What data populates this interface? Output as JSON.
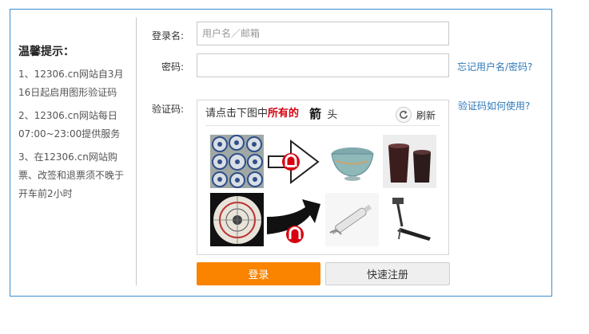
{
  "tips": {
    "title": "温馨提示：",
    "items": [
      "1、12306.cn网站自3月16日起启用图形验证码",
      "2、12306.cn网站每日07:00~23:00提供服务",
      "3、在12306.cn网站购票、改签和退票须不晚于开车前2小时"
    ]
  },
  "form": {
    "username_label": "登录名:",
    "username_placeholder": "用户名／邮箱",
    "username_value": "",
    "password_label": "密码:",
    "password_value": "",
    "forgot_link": "忘记用户名/密码?",
    "captcha_label": "验证码:",
    "captcha_help_link": "验证码如何使用?"
  },
  "captcha": {
    "prompt_prefix": "请点击下图中",
    "prompt_highlight": "所有的",
    "target_word_1": "箭",
    "target_word_2": "头",
    "refresh_label": "刷新",
    "refresh_icon": "refresh-icon",
    "tiles": [
      {
        "name": "captcha-tile-1",
        "subject": "blue-white-teacups"
      },
      {
        "name": "captcha-tile-2",
        "subject": "railway-logo-arrow"
      },
      {
        "name": "captcha-tile-3",
        "subject": "ceramic-bowl"
      },
      {
        "name": "captcha-tile-4",
        "subject": "dark-cups"
      },
      {
        "name": "captcha-tile-5",
        "subject": "compass-dial"
      },
      {
        "name": "captcha-tile-6",
        "subject": "railway-logo-curved-arrow"
      },
      {
        "name": "captcha-tile-7",
        "subject": "syringe-roller"
      },
      {
        "name": "captcha-tile-8",
        "subject": "treadmill"
      }
    ]
  },
  "buttons": {
    "login_label": "登录",
    "register_label": "快速注册"
  },
  "colors": {
    "frame_border": "#3a8fd1",
    "link": "#2f79b8",
    "login_button": "#fa8300",
    "highlight_red": "#d6000f"
  }
}
